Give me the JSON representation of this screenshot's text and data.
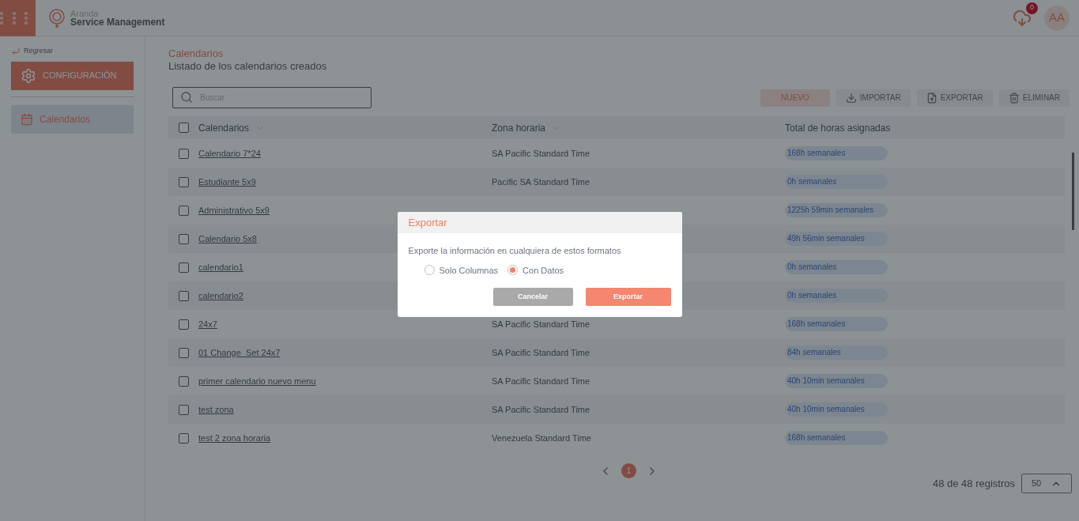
{
  "header": {
    "brand_top": "Aranda",
    "brand_bottom": "Service Management",
    "download_count": "0",
    "avatar": "AA"
  },
  "sidebar": {
    "back": "Regresar",
    "section": "CONFIGURACIÓN",
    "items": [
      {
        "label": "Calendarios",
        "selected": true
      }
    ]
  },
  "page": {
    "title": "Calendarios",
    "subtitle": "Listado de los calendarios creados"
  },
  "search": {
    "placeholder": "Buscar"
  },
  "actions": [
    {
      "label": "NUEVO",
      "kind": "primary"
    },
    {
      "label": "IMPORTAR",
      "kind": "import"
    },
    {
      "label": "EXPORTAR",
      "kind": "export"
    },
    {
      "label": "ELIMINAR",
      "kind": "delete"
    }
  ],
  "table": {
    "select_all": false,
    "columns": [
      {
        "label": "Calendarios",
        "sortable": true
      },
      {
        "label": "Zona horaria",
        "sortable": true
      },
      {
        "label": "Total de horas asignadas",
        "sortable": false
      }
    ],
    "rows": [
      {
        "checked": false,
        "name": "Calendario 7*24",
        "zone": "SA Pacific Standard Time",
        "hours": "168h semanales"
      },
      {
        "checked": false,
        "name": "Estudiante 5x9",
        "zone": "Pacific SA Standard Time",
        "hours": "0h semanales"
      },
      {
        "checked": false,
        "name": "Administrativo 5x9",
        "hours": "1225h 59min semanales"
      },
      {
        "checked": false,
        "name": "Calendario 5x8",
        "hours": "49h 56min semanales"
      },
      {
        "checked": false,
        "name": "calendario1",
        "hours": "0h semanales"
      },
      {
        "checked": false,
        "name": "calendario2",
        "hours": "0h semanales"
      },
      {
        "checked": false,
        "name": "24x7",
        "zone": "SA Pacific Standard Time",
        "hours": "168h semanales"
      },
      {
        "checked": false,
        "name": "01 Change_Set 24x7",
        "zone": "SA Pacific Standard Time",
        "hours": "84h semanales"
      },
      {
        "checked": false,
        "name": "primer calendario nuevo menu",
        "zone": "SA Pacific Standard Time",
        "hours": "40h 10min semanales"
      },
      {
        "checked": false,
        "name": "test zona",
        "zone": "SA Pacific Standard Time",
        "hours": "40h 10min semanales"
      },
      {
        "checked": false,
        "name": "test 2 zona horaria",
        "zone": "Venezuela Standard Time",
        "hours": "168h semanales"
      }
    ]
  },
  "pagination": {
    "pages": [
      {
        "label": "1",
        "selected": true
      }
    ],
    "records": "48 de 48 registros",
    "page_size": "50"
  },
  "dialog": {
    "title": "Exportar",
    "message": "Exporte la información en cualquiera de estos formatos",
    "options": [
      {
        "label": "Solo Columnas",
        "selected": false
      },
      {
        "label": "Con Datos",
        "selected": true
      }
    ],
    "cancel": "Cancelar",
    "confirm": "Exportar"
  }
}
